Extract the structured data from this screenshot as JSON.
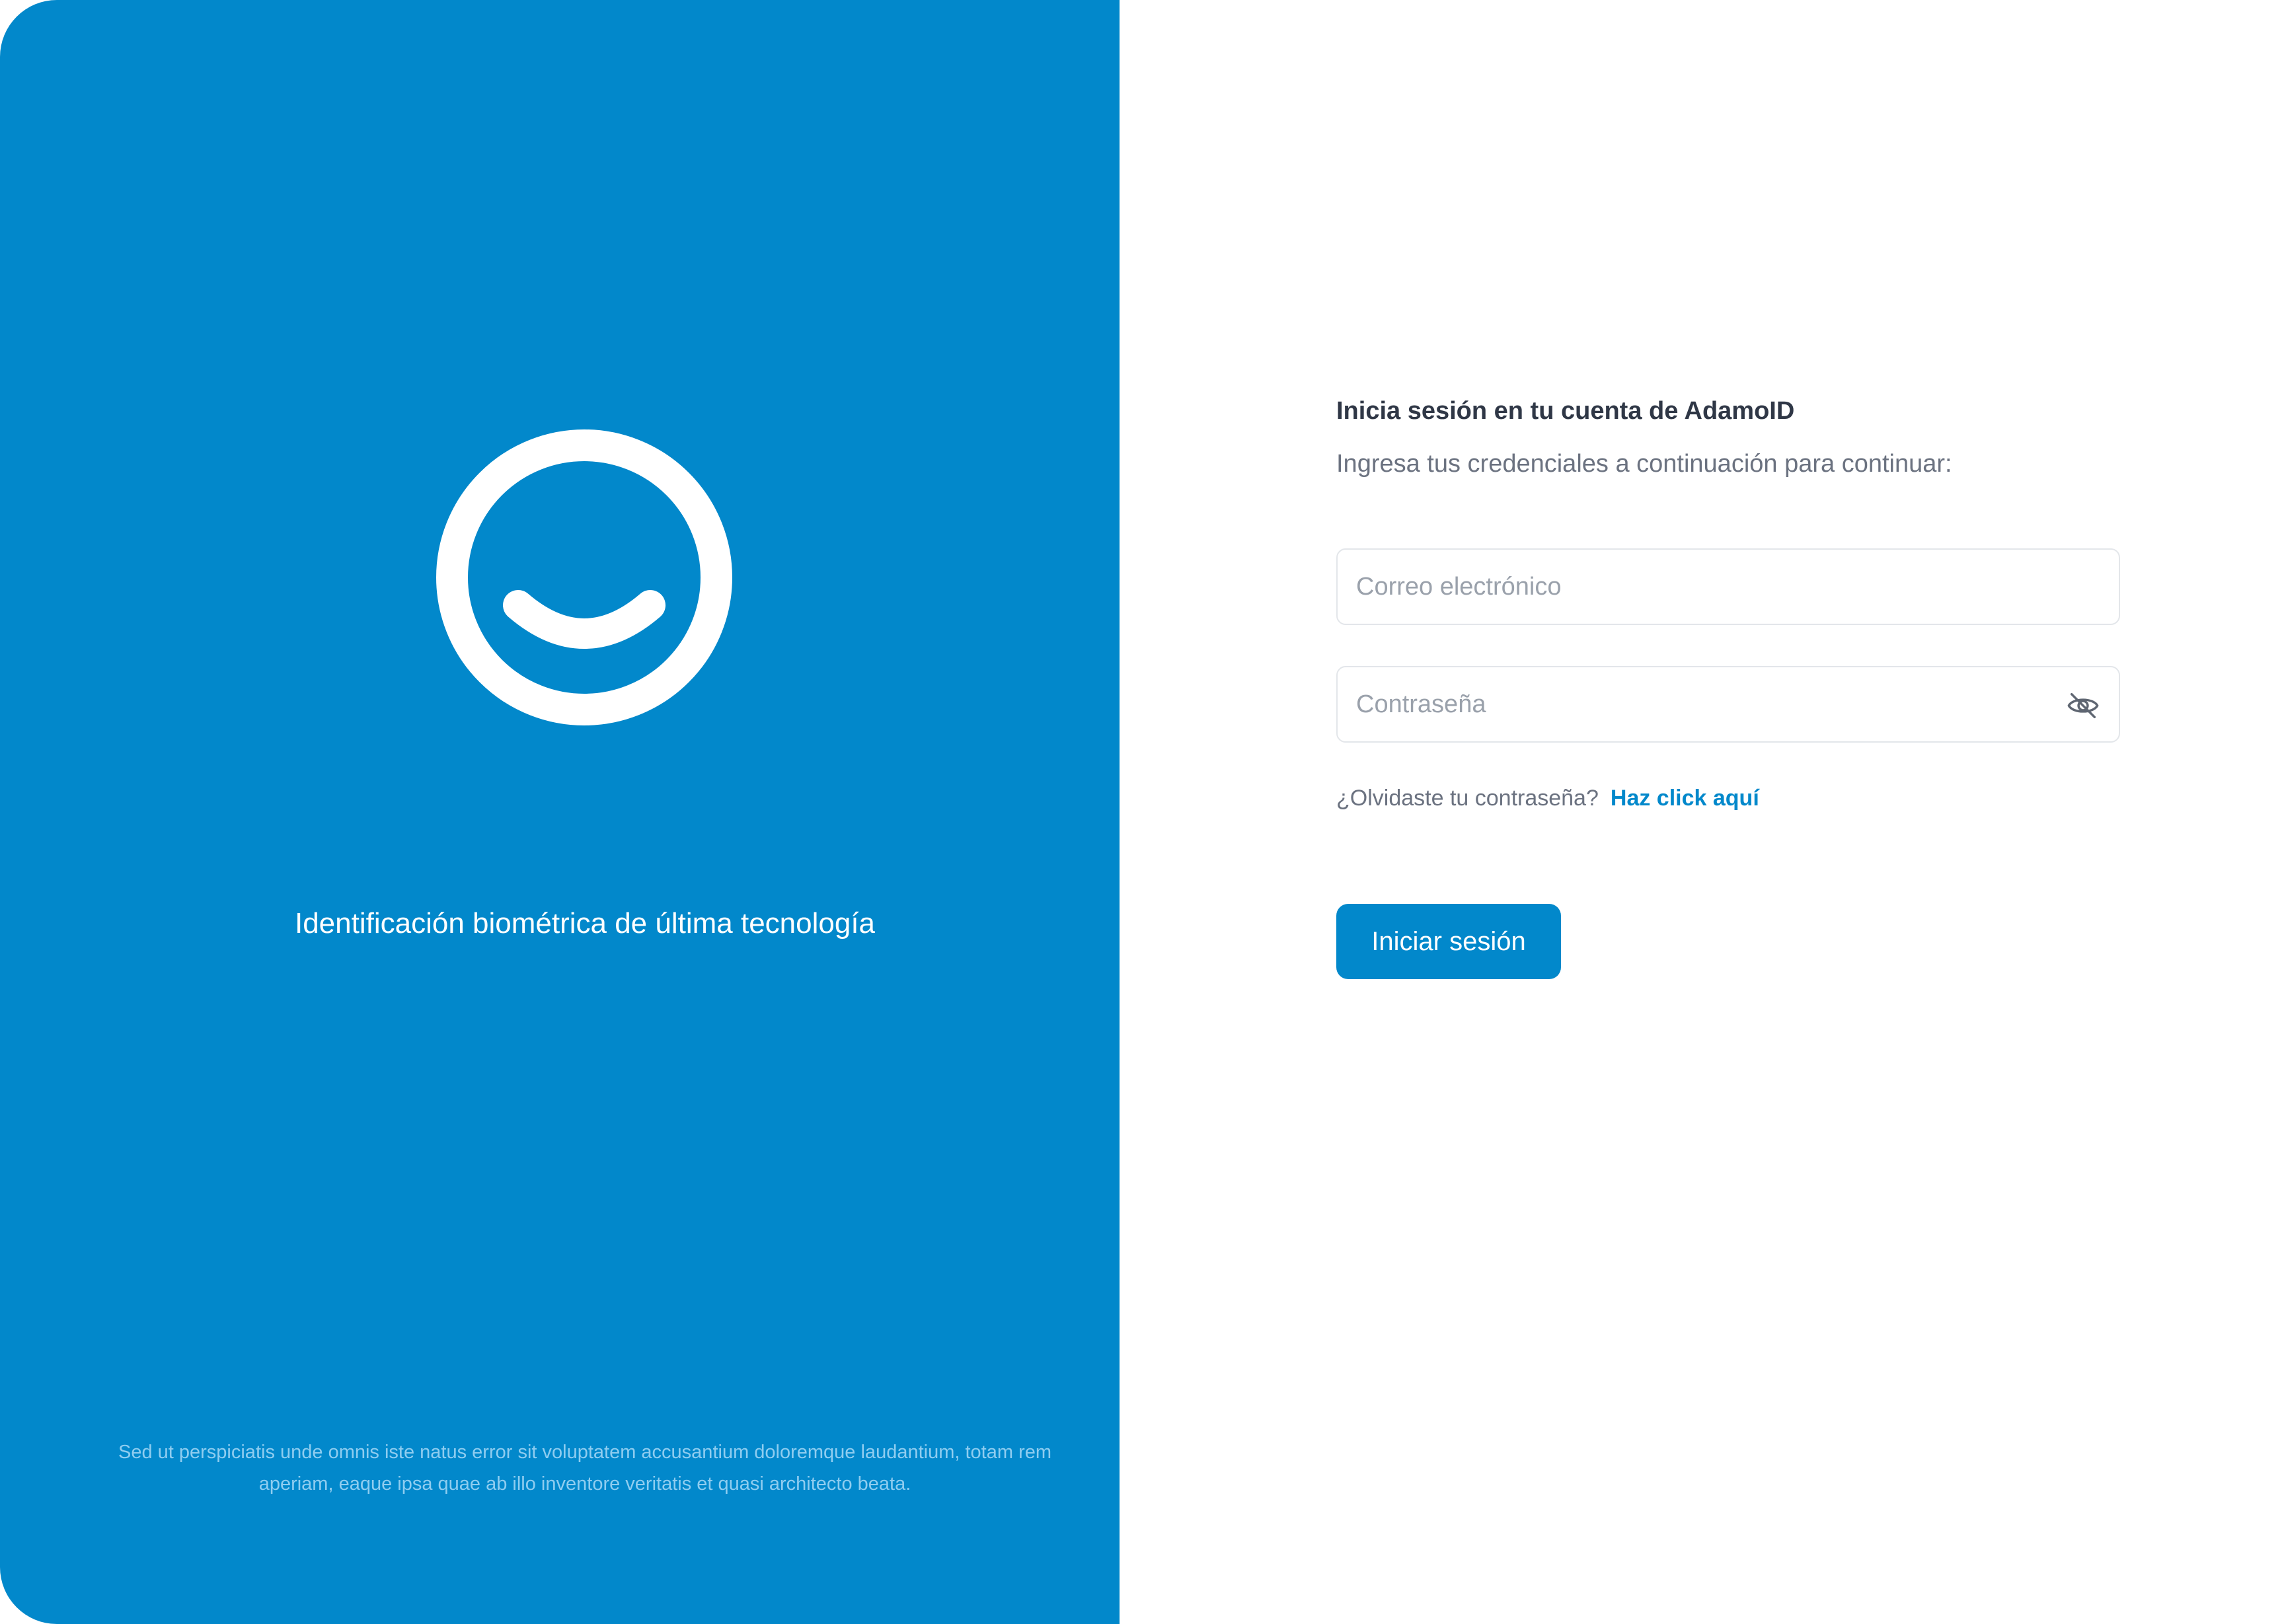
{
  "brand": {
    "logo_icon": "smiley-logo-icon",
    "tagline": "Identificación biométrica de última tecnología",
    "footer_text": "Sed ut perspiciatis unde omnis iste natus error sit voluptatem accusantium doloremque laudantium, totam rem aperiam, eaque ipsa quae ab illo inventore veritatis et quasi architecto beata."
  },
  "login": {
    "title": "Inicia sesión en tu cuenta de AdamoID",
    "subtitle": "Ingresa tus credenciales a continuación para continuar:",
    "email": {
      "placeholder": "Correo electrónico",
      "value": ""
    },
    "password": {
      "placeholder": "Contraseña",
      "value": "",
      "toggle_icon": "eye-off-icon"
    },
    "forgot_text": "¿Olvidaste tu contraseña?",
    "forgot_link": "Haz click aquí",
    "submit_label": "Iniciar sesión"
  },
  "colors": {
    "brand_blue": "#0288cb",
    "title_text": "#2f3746",
    "muted_text": "#6b7280",
    "placeholder_text": "#9aa1ab",
    "field_border": "#e3e6ea",
    "footer_text": "#8fcdf0"
  }
}
